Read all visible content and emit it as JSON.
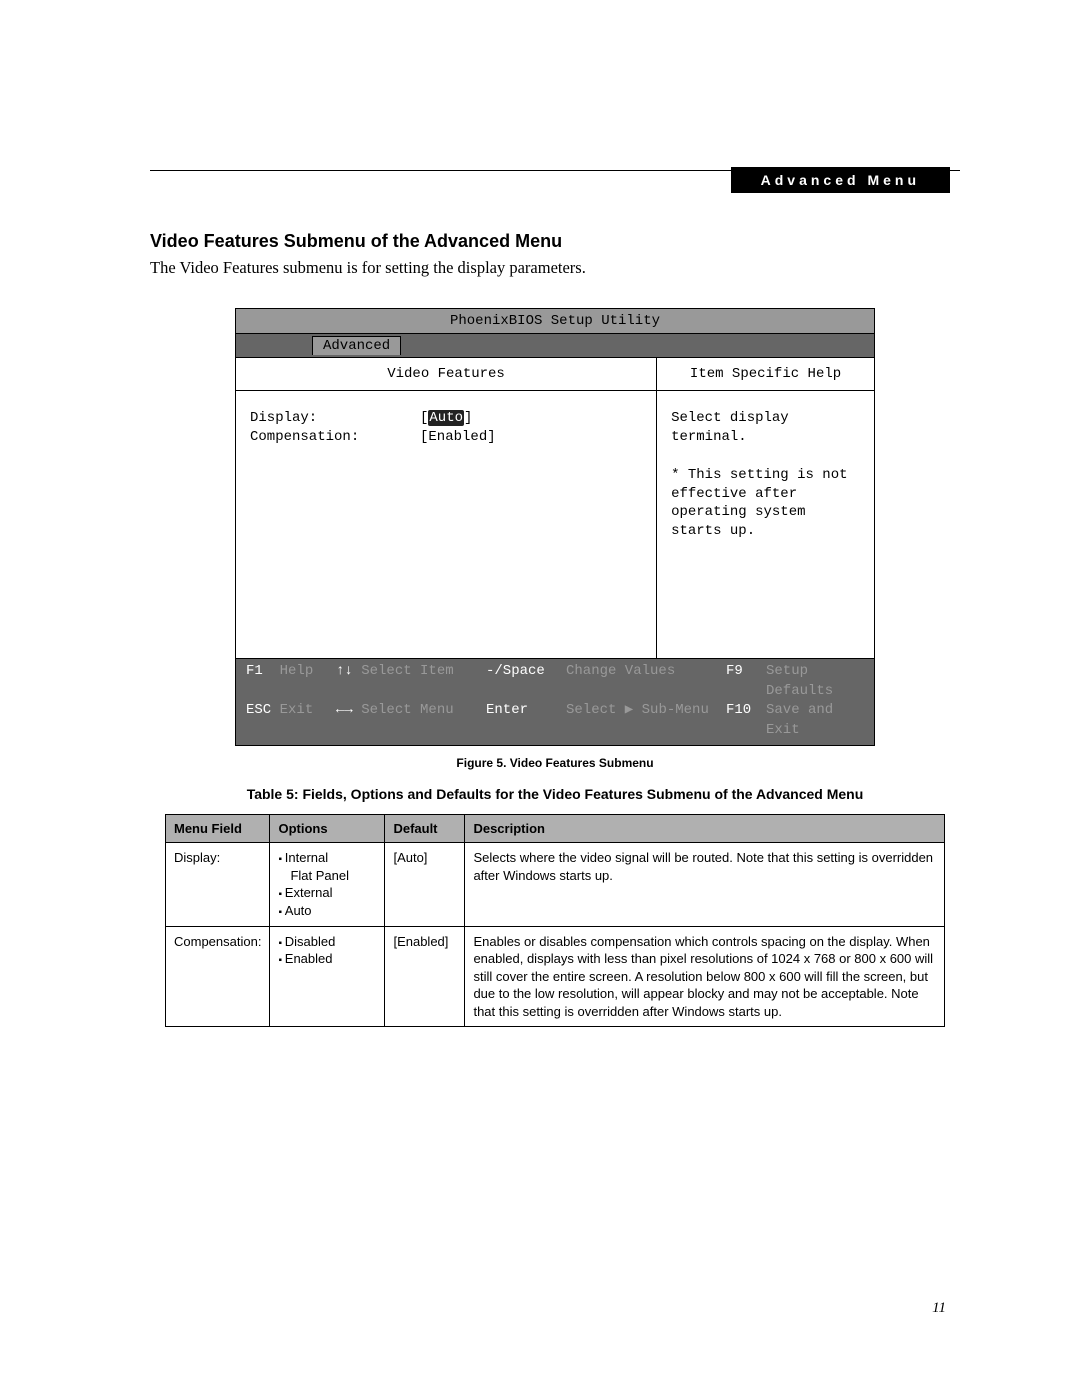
{
  "header": {
    "banner_label": "Advanced Menu"
  },
  "section": {
    "title": "Video Features Submenu of the Advanced Menu",
    "intro": "The Video Features submenu is for setting the display parameters."
  },
  "bios": {
    "utility_title": "PhoenixBIOS Setup Utility",
    "active_tab": "Advanced",
    "left_header": "Video Features",
    "right_header": "Item Specific Help",
    "settings": [
      {
        "label": "Display:",
        "value": "Auto",
        "selected": true,
        "bracketed": false
      },
      {
        "label": "Compensation:",
        "value": "Enabled",
        "selected": false,
        "bracketed": true
      }
    ],
    "help_text": "Select display terminal.\n\n* This setting is not effective after operating system starts up.",
    "footer": {
      "row1": {
        "k1": "F1",
        "l1": "Help",
        "k2": "↑↓",
        "l2": "Select Item",
        "k3": "-/Space",
        "l3": "Change Values",
        "k4": "F9",
        "l4": "Setup Defaults"
      },
      "row2": {
        "k1": "ESC",
        "l1": "Exit",
        "k2": "←→",
        "l2": "Select Menu",
        "k3": "Enter",
        "l3": "Select ▶ Sub-Menu",
        "k4": "F10",
        "l4": "Save and Exit"
      }
    }
  },
  "figure_caption": "Figure 5.  Video Features Submenu",
  "table_title": "Table 5: Fields, Options and Defaults for the Video Features Submenu of the Advanced Menu",
  "table": {
    "headers": {
      "c1": "Menu Field",
      "c2": "Options",
      "c3": "Default",
      "c4": "Description"
    },
    "rows": [
      {
        "field": "Display:",
        "options": [
          "Internal",
          "Flat Panel",
          "External",
          "Auto"
        ],
        "indent_idx": 1,
        "default": "[Auto]",
        "desc": "Selects where the video signal will be routed. Note that this setting is overridden after Windows starts up."
      },
      {
        "field": "Compensation:",
        "options": [
          "Disabled",
          "Enabled"
        ],
        "indent_idx": -1,
        "default": "[Enabled]",
        "desc": "Enables or disables compensation which controls spacing on the display. When enabled, displays with less than pixel resolutions of 1024 x 768 or 800 x 600 will still cover the entire screen. A resolution below 800 x 600 will fill the screen, but due to the low resolution, will appear blocky and may not be acceptable. Note that this setting is overridden after Windows starts up."
      }
    ]
  },
  "page_number": "11"
}
